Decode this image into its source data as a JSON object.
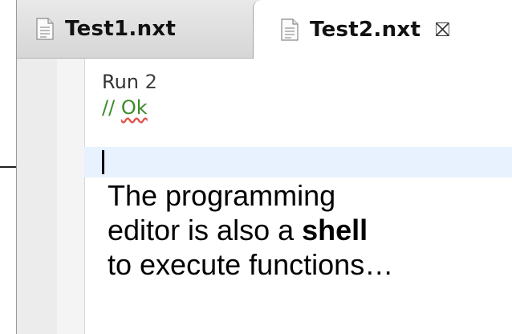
{
  "tabs": [
    {
      "label": "Test1.nxt",
      "icon": "file-icon",
      "active": false
    },
    {
      "label": "Test2.nxt",
      "icon": "file-icon",
      "active": true,
      "close": "⛝"
    }
  ],
  "editor": {
    "lines": [
      {
        "keyword": "Run",
        "arg": "2"
      },
      {
        "comment_prefix": "// ",
        "comment_word": "Ok"
      }
    ]
  },
  "annotation": {
    "line1": "The programming",
    "line2_prefix": "editor is also a ",
    "line2_bold": "shell",
    "line3": "to execute functions…"
  },
  "colors": {
    "comment": "#3b8c2a",
    "current_line": "#e8f2fe",
    "spellcheck_underline": "#e0544c"
  }
}
